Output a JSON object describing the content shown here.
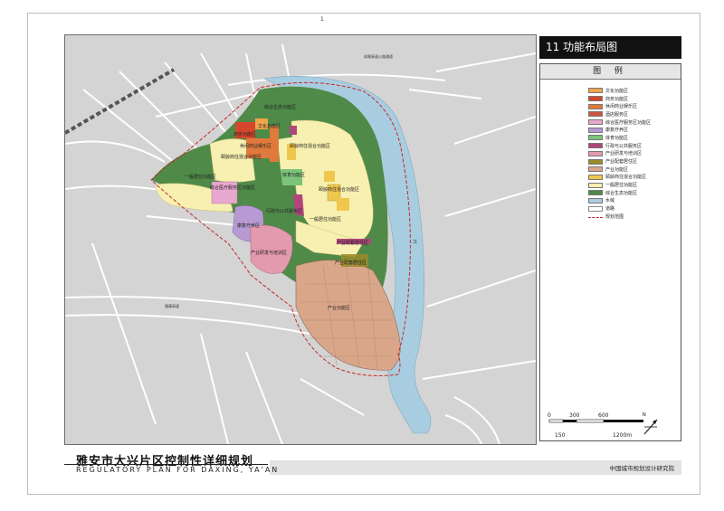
{
  "page": {
    "number": "1"
  },
  "map": {
    "title": "11  功能布局图",
    "legend_title": "图  例",
    "legend": [
      {
        "label": "文化功能区",
        "color": "#f0a64a"
      },
      {
        "label": "商务功能区",
        "color": "#d5462c"
      },
      {
        "label": "休闲商业娱乐区",
        "color": "#e07a3c"
      },
      {
        "label": "酒店服务区",
        "color": "#c9563e"
      },
      {
        "label": "综合医疗服务区功能区",
        "color": "#e9a8cf"
      },
      {
        "label": "康复疗养区",
        "color": "#b79ad4"
      },
      {
        "label": "体育功能区",
        "color": "#7cc47a"
      },
      {
        "label": "行政与公共服务区",
        "color": "#b0467d"
      },
      {
        "label": "产业研发与培训区",
        "color": "#e39aae"
      },
      {
        "label": "产业配套居住区",
        "color": "#9a8a2a"
      },
      {
        "label": "产业功能区",
        "color": "#d9a68a"
      },
      {
        "label": "颐龄商住混合功能区",
        "color": "#f0c74e"
      },
      {
        "label": "一般居住功能区",
        "color": "#f7f0b0"
      },
      {
        "label": "综合生态功能区",
        "color": "#4f8a48"
      },
      {
        "label": "水域",
        "color": "#a9cde0"
      },
      {
        "label": "道路",
        "color": "#ffffff"
      },
      {
        "label": "规划范围",
        "color": "#c62828"
      }
    ],
    "scale": {
      "ticks": [
        "0",
        "300",
        "600",
        "150",
        "1200m"
      ]
    },
    "north_label": "N",
    "labels": {
      "expressway": "成雅高速公路通道",
      "highway": "雅康高速",
      "ecology": "综合生态功能区",
      "culture": "文化功能区",
      "business": "商务功能区",
      "leisure": "休闲商业娱乐区",
      "health_biz": "颐龄商住混合功能区",
      "residential_w": "一般居住功能区",
      "medical": "综合医疗服务区功能区",
      "admin": "行政与公共服务区",
      "rehab": "康复疗养区",
      "sports": "体育功能区",
      "health_biz_e": "颐龄商住混合功能区",
      "residential_e": "一般居住功能区",
      "training": "产业研发与培训区",
      "ind_housing": "产业配套居住区",
      "industry": "产业功能区",
      "river": "江"
    }
  },
  "footer": {
    "title_cn": "雅安市大兴片区控制性详细规划",
    "title_en": "REGULATORY  PLAN FOR DAXING, YA'AN",
    "organization": "中国城市规划设计研究院"
  }
}
